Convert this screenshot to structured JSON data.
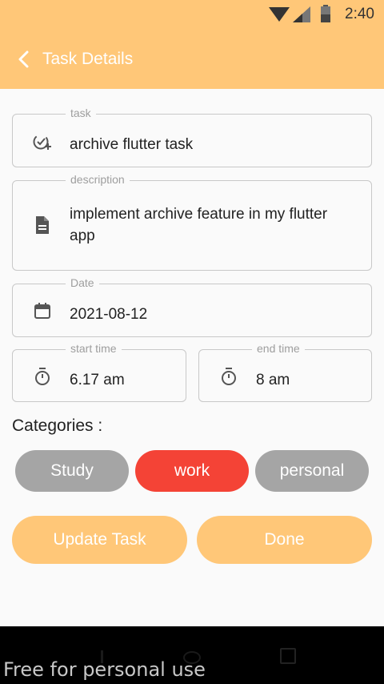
{
  "status_bar": {
    "time": "2:40"
  },
  "app_bar": {
    "title": "Task Details"
  },
  "fields": {
    "task": {
      "label": "task",
      "value": "archive flutter task"
    },
    "description": {
      "label": "description",
      "value": "implement archive feature in my flutter app"
    },
    "date": {
      "label": "Date",
      "value": "2021-08-12"
    },
    "start_time": {
      "label": "start time",
      "value": "6.17 am"
    },
    "end_time": {
      "label": "end time",
      "value": "8 am"
    }
  },
  "categories": {
    "title": "Categories :",
    "chips": [
      {
        "label": "Study",
        "color": "#a5a5a5",
        "selected": false
      },
      {
        "label": "work",
        "color": "#f44336",
        "selected": true
      },
      {
        "label": "personal",
        "color": "#a5a5a5",
        "selected": false
      }
    ]
  },
  "actions": {
    "update_label": "Update Task",
    "done_label": "Done"
  },
  "watermark": "Free for personal use",
  "colors": {
    "accent": "#ffc778",
    "selected_chip": "#f44336",
    "chip": "#a5a5a5",
    "icon": "#555555"
  }
}
